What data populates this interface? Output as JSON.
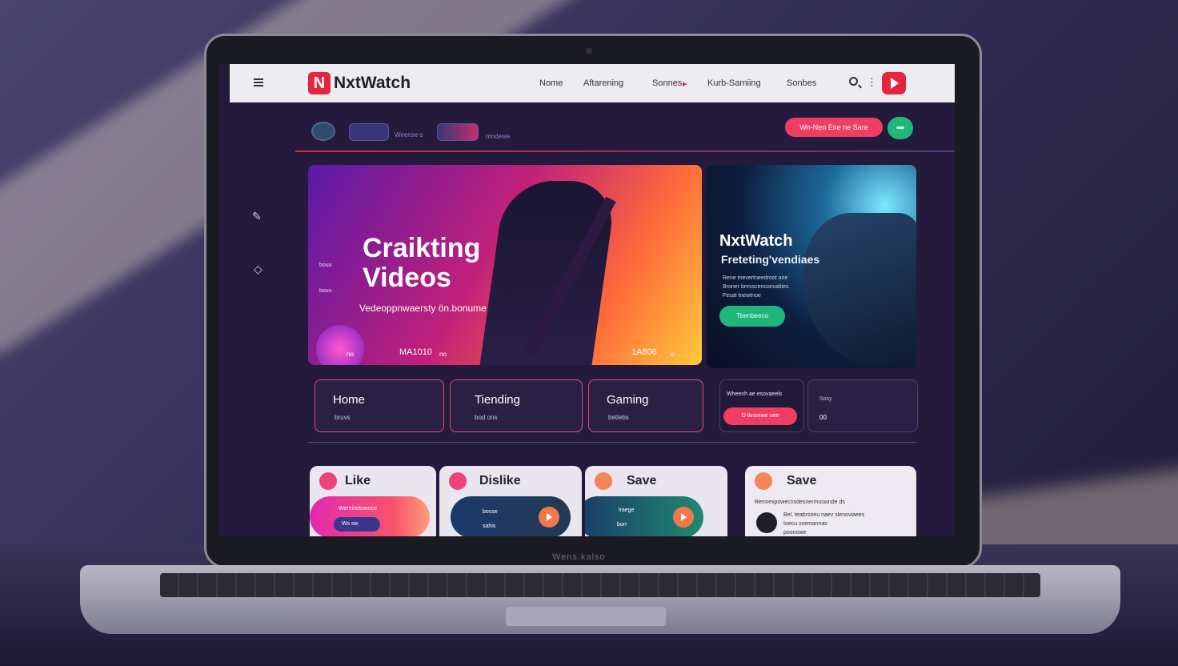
{
  "nav": {
    "logo_letter": "N",
    "logo_text": "NxtWatch",
    "links": [
      "Nome",
      "Aftarening",
      "Sonnes",
      "Kurb-Samiing",
      "Sonbes"
    ]
  },
  "toolbar": {
    "chip_label_1": "Weense s",
    "chip_label_2": "mndewe",
    "subscribe_label": "Wn-Nen Ene ne Sare"
  },
  "hero_main": {
    "title": "Craikting Videos",
    "subtitle": "Vedeoppnwaersty ön.bonume",
    "small_1": "bouu",
    "small_2": "bouu",
    "stat_1": "MA1010",
    "stat_2": "1A806",
    "stat_prefix": "no",
    "stat_suffix": "no",
    "stat_2_suffix": "w"
  },
  "hero_side": {
    "title": "NxtWatch",
    "subtitle": "Freteting'vendiaes",
    "lines": [
      "Rene tnevertneedroot ane",
      "Broner bresscenconvalties",
      "Fesat tnewtnoe"
    ],
    "button_label": "Tbenbeeco"
  },
  "categories": [
    {
      "title": "Home",
      "sub": "bruvs"
    },
    {
      "title": "Tiending",
      "sub": "bod ons"
    },
    {
      "title": "Gaming",
      "sub": "betlebs"
    }
  ],
  "promo": {
    "title": "Wheenh ae esovaeels",
    "button_label": "D iknonwe uee",
    "side_label": "Sosy",
    "side_value": "00"
  },
  "actions": [
    {
      "label": "Like",
      "line_1": "Wereinetowoce",
      "line_2": "Ws sw"
    },
    {
      "label": "Dislike",
      "line_1": "bosse",
      "line_2": "sahis"
    },
    {
      "label": "Save",
      "line_1": "lraege",
      "line_2": "borr"
    }
  ],
  "save_panel": {
    "label": "Save",
    "line_1": "Remrexpowecnsdesnermuswnde ds",
    "line_2": "Bel. teabrsneu naev slenoviaees",
    "line_3": "Ioecu svemannas",
    "line_4": "poonowe"
  },
  "laptop": {
    "brand": "Wens.kalso"
  },
  "colors": {
    "accent": "#e5253f",
    "success": "#1fb67a",
    "pink": "#f03d63"
  }
}
